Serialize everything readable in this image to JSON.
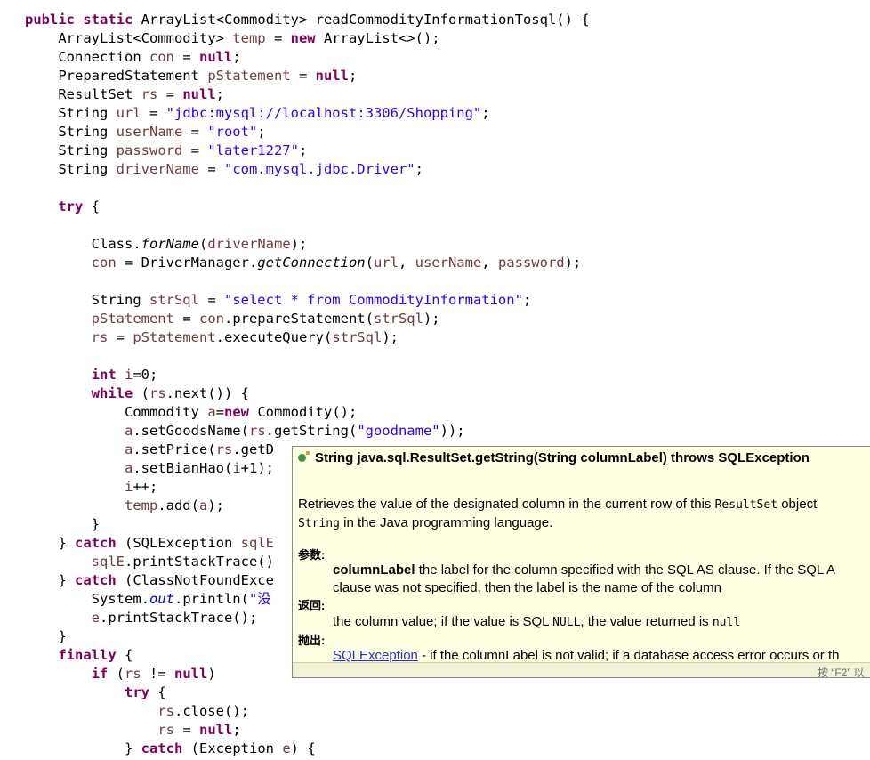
{
  "editor": {
    "code": [
      "public static ArrayList<Commodity> readCommodityInformationTosql() {",
      "    ArrayList<Commodity> temp = new ArrayList<>();",
      "    Connection con = null;",
      "    PreparedStatement pStatement = null;",
      "    ResultSet rs = null;",
      "    String url = \"jdbc:mysql://localhost:3306/Shopping\";",
      "    String userName = \"root\";",
      "    String password = \"later1227\";",
      "    String driverName = \"com.mysql.jdbc.Driver\";",
      "",
      "    try {",
      "",
      "        Class.forName(driverName);",
      "        con = DriverManager.getConnection(url, userName, password);",
      "",
      "        String strSql = \"select * from CommodityInformation\";",
      "        pStatement = con.prepareStatement(strSql);",
      "        rs = pStatement.executeQuery(strSql);",
      "",
      "        int i=0;",
      "        while (rs.next()) {",
      "            Commodity a=new Commodity();",
      "            a.setGoodsName(rs.getString(\"goodname\"));",
      "            a.setPrice(rs.getD",
      "            a.setBianHao(i+1);",
      "            i++;",
      "            temp.add(a);",
      "        }",
      "    } catch (SQLException sqlE",
      "        sqlE.printStackTrace()",
      "    } catch (ClassNotFoundExce",
      "        System.out.println(\"没",
      "        e.printStackTrace();",
      "    }",
      "    finally {",
      "        if (rs != null)",
      "            try {",
      "                rs.close();",
      "                rs = null;",
      "            } catch (Exception e) {"
    ]
  },
  "hover": {
    "signature": "String java.sql.ResultSet.getString(String columnLabel) throws SQLException",
    "desc_a": "Retrieves the value of the designated column in the current row of this",
    "desc_code1": "ResultSet",
    "desc_b": "object",
    "desc_code2": "String",
    "desc_c": "in the Java programming language.",
    "params_label": "参数:",
    "param_name": "columnLabel",
    "param_desc1": "the label for the column specified with the SQL AS clause. If the SQL A",
    "param_desc2": "clause was not specified, then the label is the name of the column",
    "returns_label": "返回:",
    "ret_a": "the column value; if the value is SQL",
    "ret_code1": "NULL",
    "ret_b": ", the value returned is",
    "ret_code2": "null",
    "throws_label": "抛出:",
    "throws_link": "SQLException",
    "throws_desc": "- if the columnLabel is not valid; if a database access error occurs or th",
    "footer": "按 “F2” 以"
  }
}
